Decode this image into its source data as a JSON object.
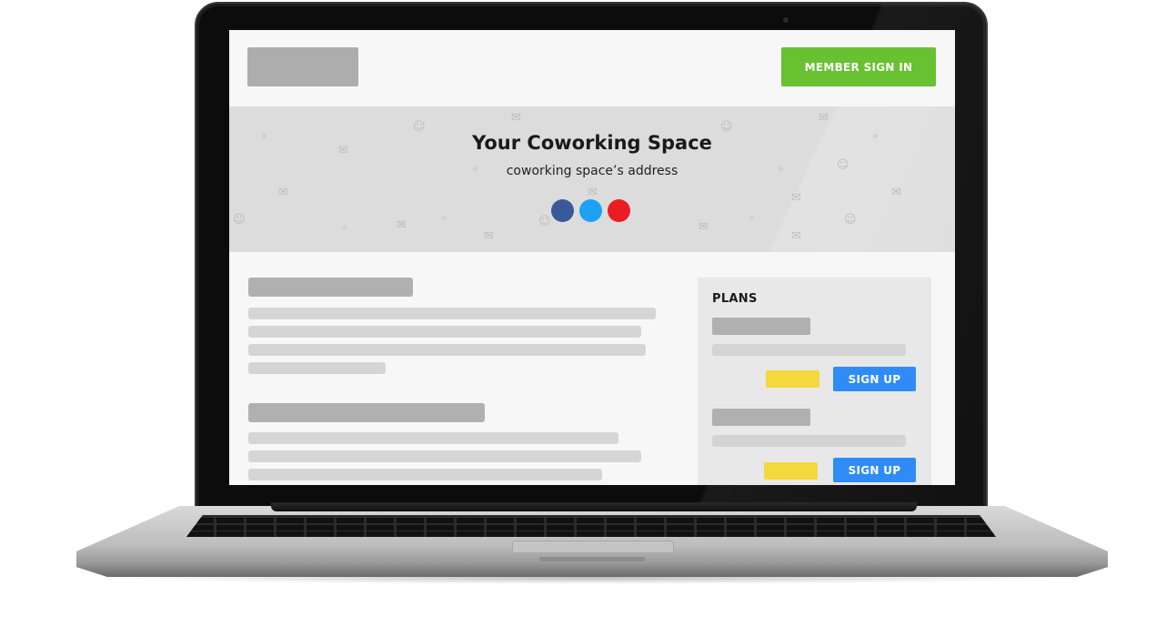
{
  "header": {
    "member_sign_in_label": "MEMBER SIGN IN"
  },
  "hero": {
    "title": "Your Coworking Space",
    "subtitle": "coworking space’s address",
    "social_icons": [
      {
        "name": "facebook-icon",
        "color": "#3b5998"
      },
      {
        "name": "twitter-icon",
        "color": "#1da1f2"
      },
      {
        "name": "youtube-icon",
        "color": "#ec1c24"
      }
    ]
  },
  "plans": {
    "title": "PLANS",
    "items": [
      {
        "signup_label": "SIGN UP"
      },
      {
        "signup_label": "SIGN UP"
      }
    ]
  },
  "colors": {
    "member_button": "#68c130",
    "signup_button": "#2f8cf6",
    "price_placeholder": "#f4d83c",
    "hero_background": "#dcdcdc"
  }
}
